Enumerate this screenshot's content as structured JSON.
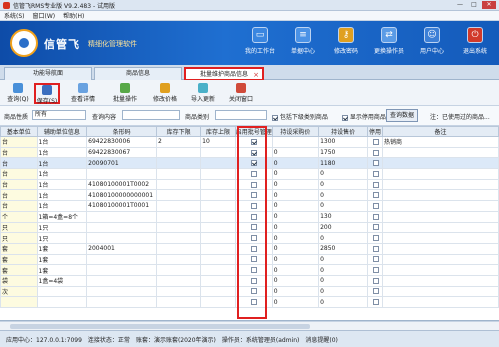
{
  "window": {
    "title": "信管飞RMS专业版 V9.2.483 - 试用版",
    "controls": [
      "—",
      "□",
      "✕"
    ]
  },
  "menu": [
    "系统(S)",
    "窗口(W)",
    "帮助(H)"
  ],
  "banner": {
    "brand": "信管飞",
    "slogan": "精细化管理软件",
    "buttons": [
      {
        "label": "我的工作台",
        "icon": "desktop-icon"
      },
      {
        "label": "单据中心",
        "icon": "document-icon"
      },
      {
        "label": "修改密码",
        "icon": "key-icon"
      },
      {
        "label": "更换操作员",
        "icon": "user-switch-icon"
      },
      {
        "label": "用户中心",
        "icon": "user-icon"
      },
      {
        "label": "退出系统",
        "icon": "power-icon"
      }
    ]
  },
  "tabs": [
    {
      "label": "功能导航面"
    },
    {
      "label": "商品信息"
    },
    {
      "label": "批量维护商品信息",
      "active": true
    }
  ],
  "toolbar": [
    {
      "label": "查询(Q)",
      "icon": "refresh-icon"
    },
    {
      "label": "保存(S)",
      "icon": "save-icon",
      "highlight": true
    },
    {
      "label": "查看详情",
      "icon": "details-icon"
    },
    {
      "label": "批量操作",
      "icon": "batch-icon"
    },
    {
      "label": "修改价格",
      "icon": "price-icon"
    },
    {
      "label": "导入更新",
      "icon": "import-icon"
    },
    {
      "label": "关闭窗口",
      "icon": "close-window-icon"
    }
  ],
  "filter": {
    "type_label": "商品性质",
    "type_value": "所有",
    "query_label": "查询内容",
    "category_label": "商品类别",
    "include_sub": "包括下级类别商品",
    "show_disabled": "显示停用商品",
    "query_button": "查询数据",
    "note": "注：已使用过的商品..."
  },
  "columns": [
    "基本单位",
    "辅助单位信息",
    "条形码",
    "库存下限",
    "库存上限",
    "启用批号管理",
    "持设采购价",
    "持设售价",
    "停用",
    "备注"
  ],
  "rows": [
    {
      "unit": "台",
      "aux": "1台",
      "barcode": "69422830006",
      "min": "2",
      "max": "10",
      "batch": true,
      "purchase": "",
      "sale": "1300",
      "remark": "热销商"
    },
    {
      "unit": "台",
      "aux": "1台",
      "barcode": "69422830067",
      "min": "",
      "max": "",
      "batch": true,
      "purchase": "0",
      "sale": "1750",
      "remark": ""
    },
    {
      "unit": "台",
      "aux": "1台",
      "barcode": "20090701",
      "min": "",
      "max": "",
      "batch": true,
      "purchase": "0",
      "sale": "1180",
      "remark": "",
      "selected": true
    },
    {
      "unit": "台",
      "aux": "1台",
      "barcode": "",
      "min": "",
      "max": "",
      "batch": false,
      "purchase": "0",
      "sale": "0",
      "remark": ""
    },
    {
      "unit": "台",
      "aux": "1台",
      "barcode": "41080100001T0002",
      "min": "",
      "max": "",
      "batch": false,
      "purchase": "0",
      "sale": "0",
      "remark": ""
    },
    {
      "unit": "台",
      "aux": "1台",
      "barcode": "41080100000000001",
      "min": "",
      "max": "",
      "batch": false,
      "purchase": "0",
      "sale": "0",
      "remark": ""
    },
    {
      "unit": "台",
      "aux": "1台",
      "barcode": "41080100001T0001",
      "min": "",
      "max": "",
      "batch": false,
      "purchase": "0",
      "sale": "0",
      "remark": ""
    },
    {
      "unit": "个",
      "aux": "1箱=4盒=8个",
      "barcode": "",
      "min": "",
      "max": "",
      "batch": false,
      "purchase": "0",
      "sale": "130",
      "remark": ""
    },
    {
      "unit": "只",
      "aux": "1只",
      "barcode": "",
      "min": "",
      "max": "",
      "batch": false,
      "purchase": "0",
      "sale": "200",
      "remark": ""
    },
    {
      "unit": "只",
      "aux": "1只",
      "barcode": "",
      "min": "",
      "max": "",
      "batch": false,
      "purchase": "0",
      "sale": "0",
      "remark": ""
    },
    {
      "unit": "套",
      "aux": "1套",
      "barcode": "2004001",
      "min": "",
      "max": "",
      "batch": false,
      "purchase": "0",
      "sale": "2850",
      "remark": ""
    },
    {
      "unit": "套",
      "aux": "1套",
      "barcode": "",
      "min": "",
      "max": "",
      "batch": false,
      "purchase": "0",
      "sale": "0",
      "remark": ""
    },
    {
      "unit": "套",
      "aux": "1套",
      "barcode": "",
      "min": "",
      "max": "",
      "batch": false,
      "purchase": "0",
      "sale": "0",
      "remark": ""
    },
    {
      "unit": "袋",
      "aux": "1盒=4袋",
      "barcode": "",
      "min": "",
      "max": "",
      "batch": false,
      "purchase": "0",
      "sale": "0",
      "remark": ""
    },
    {
      "unit": "次",
      "aux": "",
      "barcode": "",
      "min": "",
      "max": "",
      "batch": false,
      "purchase": "0",
      "sale": "0",
      "remark": ""
    },
    {
      "unit": "",
      "aux": "",
      "barcode": "",
      "min": "",
      "max": "",
      "batch": false,
      "purchase": "0",
      "sale": "0",
      "remark": ""
    }
  ],
  "status": {
    "server": "应用中心：127.0.0.1:7099",
    "conn": "连接状态：正常",
    "account": "账套：演示账套(2020年演示)",
    "operator": "操作员：系统管理员(admin)",
    "msg": "消息提醒(0)"
  },
  "colors": {
    "banner": "#1f6fd1",
    "highlight": "#e02020"
  }
}
